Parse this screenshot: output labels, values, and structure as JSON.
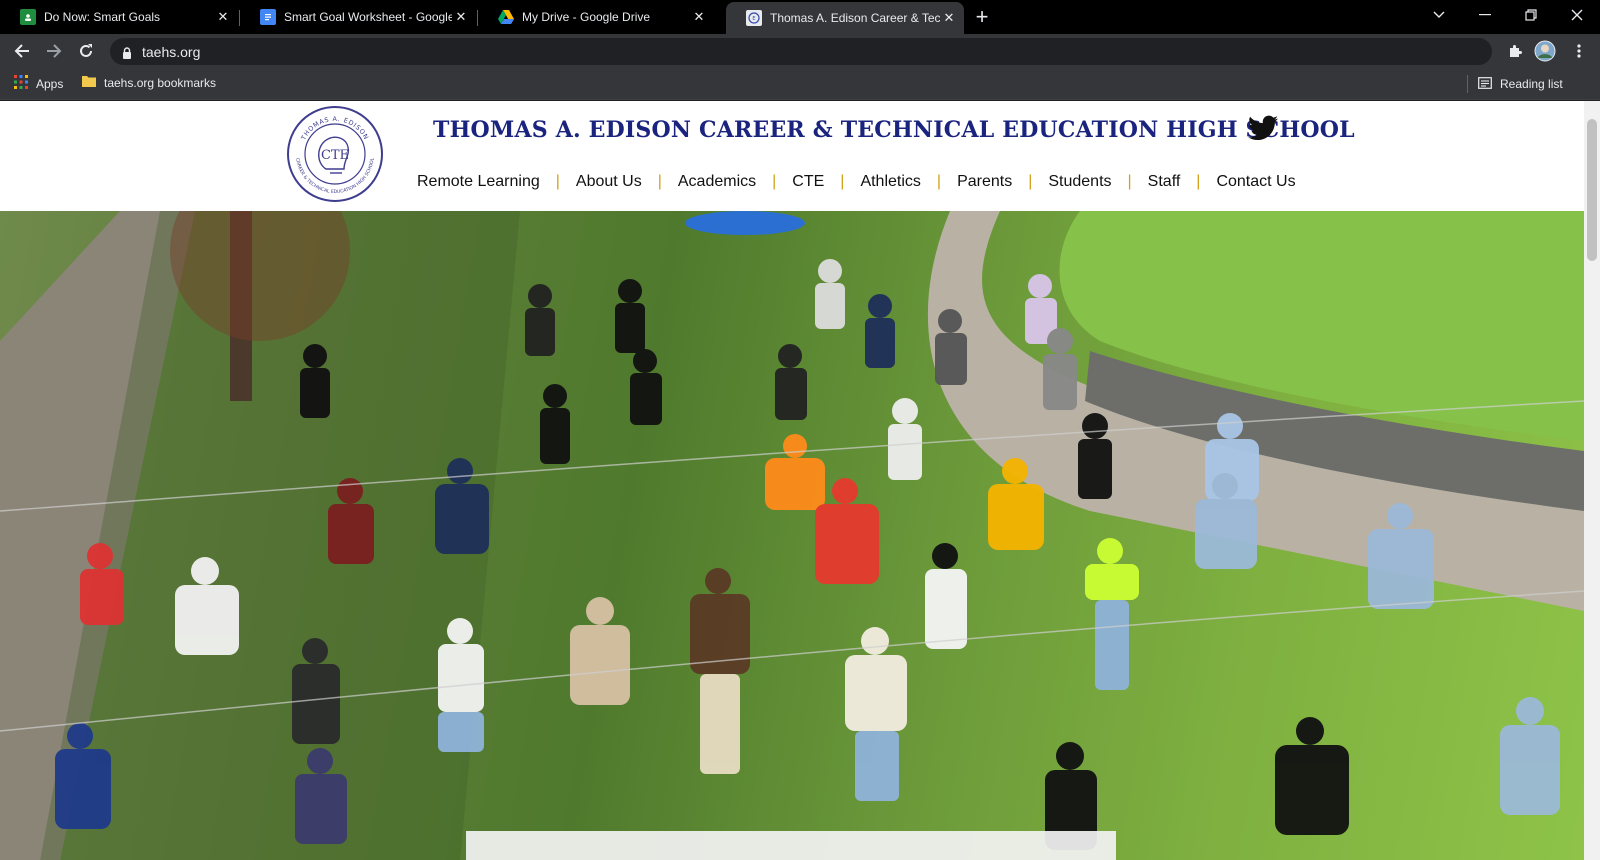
{
  "browser": {
    "tabs": [
      {
        "title": "Do Now: Smart Goals",
        "icon": "google-classroom-icon",
        "active": false
      },
      {
        "title": "Smart Goal Worksheet - Google",
        "icon": "google-docs-icon",
        "active": false
      },
      {
        "title": "My Drive - Google Drive",
        "icon": "google-drive-icon",
        "active": false
      },
      {
        "title": "Thomas A. Edison Career & Techr",
        "icon": "taehs-favicon",
        "active": true
      }
    ],
    "url": "taehs.org",
    "bookmarks": [
      {
        "label": "Apps",
        "icon": "apps-grid-icon"
      },
      {
        "label": "taehs.org bookmarks",
        "icon": "folder-icon"
      }
    ],
    "reading_list": "Reading list"
  },
  "site": {
    "title": "THOMAS A. EDISON CAREER & TECHNICAL EDUCATION HIGH SCHOOL",
    "logo_text": {
      "top": "THOMAS A. EDISON",
      "center": "CTE",
      "ring": "CAREER & TECHNICAL EDUCATION HIGH SCHOOL"
    },
    "nav": [
      "Remote Learning",
      "About Us",
      "Academics",
      "CTE",
      "Athletics",
      "Parents",
      "Students",
      "Staff",
      "Contact Us"
    ],
    "colors": {
      "title": "#1a237e",
      "nav_separator": "#d4a017"
    }
  }
}
